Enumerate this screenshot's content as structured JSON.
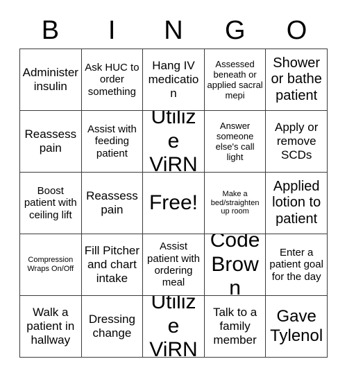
{
  "header": {
    "letters": [
      "B",
      "I",
      "N",
      "G",
      "O"
    ]
  },
  "grid": {
    "rows": 5,
    "columns": 5,
    "border_color": "#3a3a3a",
    "background_color": "#ffffff",
    "text_color": "#000000",
    "cells": [
      {
        "text": "Administer insulin",
        "size": "md"
      },
      {
        "text": "Ask HUC to order something",
        "size": "sm"
      },
      {
        "text": "Hang IV medication",
        "size": "md"
      },
      {
        "text": "Assessed beneath or applied sacral mepi",
        "size": "xs"
      },
      {
        "text": "Shower or bathe patient",
        "size": "lg"
      },
      {
        "text": "Reassess pain",
        "size": "md"
      },
      {
        "text": "Assist with feeding patient",
        "size": "sm"
      },
      {
        "text": "Utilize ViRN",
        "size": "xxl"
      },
      {
        "text": "Answer someone else's call light",
        "size": "xs"
      },
      {
        "text": "Apply or remove SCDs",
        "size": "md"
      },
      {
        "text": "Boost patient with ceiling lift",
        "size": "sm"
      },
      {
        "text": "Reassess pain",
        "size": "md"
      },
      {
        "text": "Free!",
        "size": "xxl"
      },
      {
        "text": "Make a bed/straighten up room",
        "size": "xxs"
      },
      {
        "text": "Applied lotion to patient",
        "size": "lg"
      },
      {
        "text": "Compression Wraps On/Off",
        "size": "xxs"
      },
      {
        "text": "Fill Pitcher and chart intake",
        "size": "md"
      },
      {
        "text": "Assist patient with ordering meal",
        "size": "sm"
      },
      {
        "text": "Code Brown",
        "size": "xxl"
      },
      {
        "text": "Enter a patient goal for the day",
        "size": "sm"
      },
      {
        "text": "Walk a patient in hallway",
        "size": "md"
      },
      {
        "text": "Dressing change",
        "size": "md"
      },
      {
        "text": "Utilize ViRN",
        "size": "xxl"
      },
      {
        "text": "Talk to a family member",
        "size": "md"
      },
      {
        "text": "Gave Tylenol",
        "size": "xl"
      }
    ]
  }
}
